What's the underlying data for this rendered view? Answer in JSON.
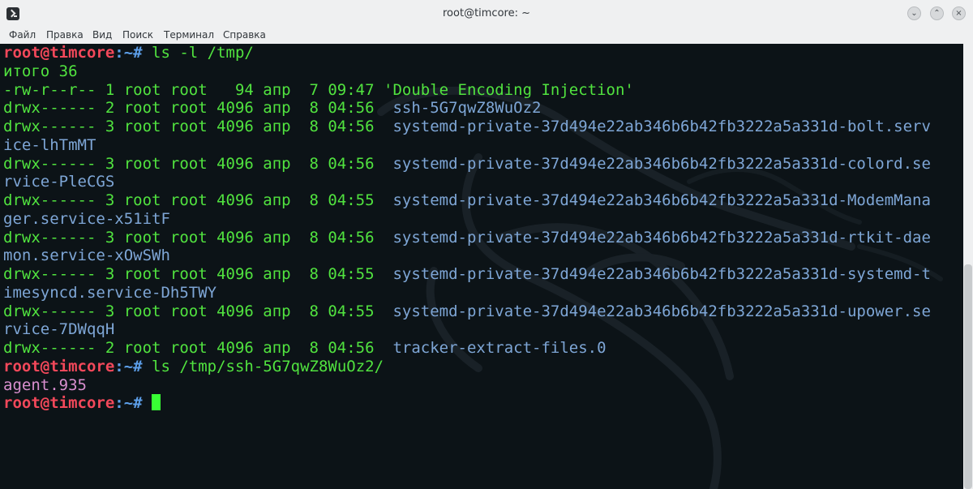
{
  "window": {
    "title": "root@timcore: ~",
    "buttons": [
      "minimize",
      "maximize",
      "close"
    ]
  },
  "menubar": {
    "items": [
      "Файл",
      "Правка",
      "Вид",
      "Поиск",
      "Терминал",
      "Справка"
    ]
  },
  "terminal": {
    "lines": [
      {
        "prompt": "root@timcore",
        "path": ":~# ",
        "command": "ls -l /tmp/"
      },
      {
        "text": "итого 36",
        "color": "green"
      },
      {
        "perm": "-rw-r--r-- 1 root root   94 апр  7 09:47 ",
        "name": "'Double Encoding Injection'",
        "name_color": "green"
      },
      {
        "perm": "drwx------ 2 root root 4096 апр  8 04:56  ",
        "name": "ssh-5G7qwZ8WuOz2",
        "name_color": "blue"
      },
      {
        "perm": "drwx------ 3 root root 4096 апр  8 04:56  ",
        "name": "systemd-private-37d494e22ab346b6b42fb3222a5a331d-bolt.serv",
        "name_color": "blue"
      },
      {
        "text": "ice-lhTmMT",
        "color": "blue"
      },
      {
        "perm": "drwx------ 3 root root 4096 апр  8 04:56  ",
        "name": "systemd-private-37d494e22ab346b6b42fb3222a5a331d-colord.se",
        "name_color": "blue"
      },
      {
        "text": "rvice-PleCGS",
        "color": "blue"
      },
      {
        "perm": "drwx------ 3 root root 4096 апр  8 04:55  ",
        "name": "systemd-private-37d494e22ab346b6b42fb3222a5a331d-ModemMana",
        "name_color": "blue"
      },
      {
        "text": "ger.service-x51itF",
        "color": "blue"
      },
      {
        "perm": "drwx------ 3 root root 4096 апр  8 04:56  ",
        "name": "systemd-private-37d494e22ab346b6b42fb3222a5a331d-rtkit-dae",
        "name_color": "blue"
      },
      {
        "text": "mon.service-xOwSWh",
        "color": "blue"
      },
      {
        "perm": "drwx------ 3 root root 4096 апр  8 04:55  ",
        "name": "systemd-private-37d494e22ab346b6b42fb3222a5a331d-systemd-t",
        "name_color": "blue"
      },
      {
        "text": "imesyncd.service-Dh5TWY",
        "color": "blue"
      },
      {
        "perm": "drwx------ 3 root root 4096 апр  8 04:55  ",
        "name": "systemd-private-37d494e22ab346b6b42fb3222a5a331d-upower.se",
        "name_color": "blue"
      },
      {
        "text": "rvice-7DWqqH",
        "color": "blue"
      },
      {
        "perm": "drwx------ 2 root root 4096 апр  8 04:56  ",
        "name": "tracker-extract-files.0",
        "name_color": "blue"
      },
      {
        "prompt": "root@timcore",
        "path": ":~# ",
        "command": "ls /tmp/ssh-5G7qwZ8WuOz2/"
      },
      {
        "text": "agent.935",
        "color": "magenta"
      },
      {
        "prompt": "root@timcore",
        "path": ":~# ",
        "command": "",
        "cursor": true
      }
    ]
  },
  "colors": {
    "prompt_user": "#f2485a",
    "prompt_path": "#5c9ee8",
    "green": "#51e33f",
    "blue": "#7ea6d6",
    "magenta": "#d98fcf",
    "cursor": "#38ff34",
    "background": "#0c1317"
  }
}
